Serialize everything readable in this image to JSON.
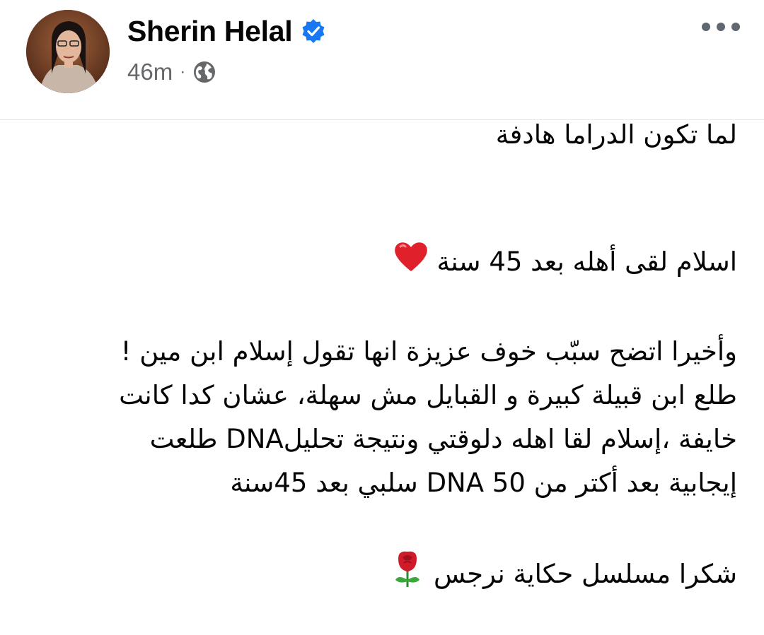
{
  "author": {
    "name": "Sherin Helal",
    "verified": true,
    "time": "46m",
    "separator": "·",
    "audience_icon": "globe-icon"
  },
  "post": {
    "line1": "لما تكون الدراما هادفة",
    "line2": "اسلام لقى أهله بعد 45 سنة",
    "line2_emoji": "heart-emoji",
    "para": [
      "وأخيرا اتضح سبّب خوف عزيزة انها تقول إسلام ابن مين !",
      "طلع ابن قبيلة كبيرة و القبايل مش سهلة، عشان كدا كانت",
      "خايفة ،إسلام لقا اهله دلوقتي ونتيجة تحليلDNA طلعت",
      "إيجابية بعد أكتر من DNA 50 سلبي بعد 45سنة"
    ],
    "thanks": "شكرا مسلسل حكاية نرجس",
    "thanks_emoji": "rose-emoji"
  },
  "colors": {
    "verified": "#1877f2",
    "meta": "#65676b",
    "text": "#050505"
  }
}
